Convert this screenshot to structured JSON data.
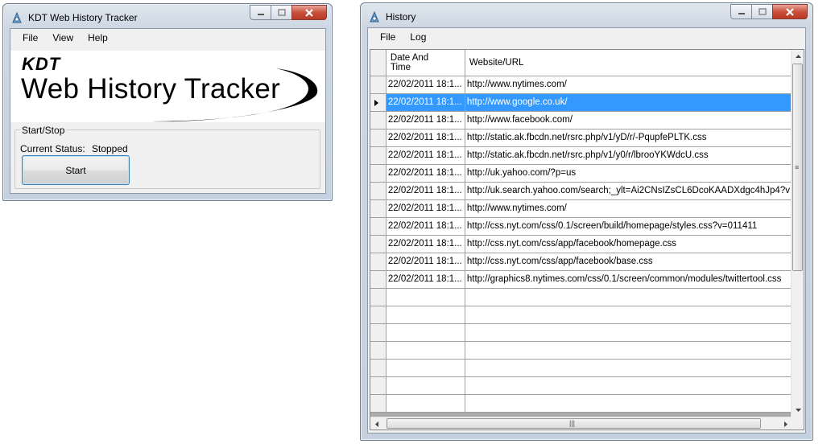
{
  "main_window": {
    "title": "KDT Web History Tracker",
    "menu": [
      "File",
      "View",
      "Help"
    ],
    "banner": {
      "brand": "KDT",
      "product": "Web History Tracker"
    },
    "group": {
      "legend": "Start/Stop",
      "status_label": "Current Status:",
      "status_value": "Stopped",
      "start_label": "Start"
    }
  },
  "history_window": {
    "title": "History",
    "menu": [
      "File",
      "Log"
    ],
    "columns": {
      "date": "Date And Time",
      "url": "Website/URL"
    },
    "rows": [
      {
        "date": "22/02/2011 18:1...",
        "url": "http://www.nytimes.com/"
      },
      {
        "date": "22/02/2011 18:1...",
        "url": "http://www.google.co.uk/",
        "selected": true
      },
      {
        "date": "22/02/2011 18:1...",
        "url": "http://www.facebook.com/"
      },
      {
        "date": "22/02/2011 18:1...",
        "url": "http://static.ak.fbcdn.net/rsrc.php/v1/yD/r/-PqupfePLTK.css"
      },
      {
        "date": "22/02/2011 18:1...",
        "url": "http://static.ak.fbcdn.net/rsrc.php/v1/y0/r/lbrooYKWdcU.css"
      },
      {
        "date": "22/02/2011 18:1...",
        "url": "http://uk.yahoo.com/?p=us"
      },
      {
        "date": "22/02/2011 18:1...",
        "url": "http://uk.search.yahoo.com/search;_ylt=Ai2CNsIZsCL6DcoKAADXdgc4hJp4?v"
      },
      {
        "date": "22/02/2011 18:1...",
        "url": "http://www.nytimes.com/"
      },
      {
        "date": "22/02/2011 18:1...",
        "url": "http://css.nyt.com/css/0.1/screen/build/homepage/styles.css?v=011411"
      },
      {
        "date": "22/02/2011 18:1...",
        "url": "http://css.nyt.com/css/app/facebook/homepage.css"
      },
      {
        "date": "22/02/2011 18:1...",
        "url": "http://css.nyt.com/css/app/facebook/base.css"
      },
      {
        "date": "22/02/2011 18:1...",
        "url": "http://graphics8.nytimes.com/css/0.1/screen/common/modules/twittertool.css"
      }
    ],
    "empty_rows": 7
  },
  "icons": {
    "app": "app-icon",
    "minimize": "minimize-icon",
    "maximize": "maximize-icon",
    "close": "close-icon",
    "row_selector": "row-selector-arrow-icon"
  },
  "colors": {
    "selection": "#3399ff",
    "close_button": "#c9503c"
  }
}
